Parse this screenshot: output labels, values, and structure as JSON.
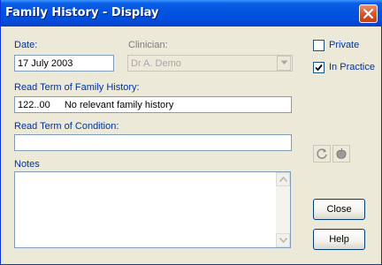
{
  "window": {
    "title": "Family History - Display",
    "close_glyph": "×"
  },
  "form": {
    "date_label": "Date:",
    "date_value": "17 July 2003",
    "clinician_label": "Clinician:",
    "clinician_value": "Dr A. Demo",
    "read_term_family_label": "Read Term of Family History:",
    "read_term_family_code": "122..00",
    "read_term_family_text": "No relevant family history",
    "read_term_condition_label": "Read Term of Condition:",
    "read_term_condition_value": "",
    "notes_label": "Notes",
    "notes_value": ""
  },
  "options": {
    "private_label": "Private",
    "private_checked": false,
    "in_practice_label": "In Practice",
    "in_practice_checked": true
  },
  "buttons": {
    "close_label": "Close",
    "help_label": "Help"
  },
  "icons": {
    "close": "close-icon",
    "checkmark": "checkmark-icon",
    "refresh": "refresh-icon",
    "apple": "apple-icon",
    "dropdown": "chevron-down-icon"
  },
  "colors": {
    "titlebar": "#0454df",
    "label": "#003399",
    "window_bg": "#ece9d8",
    "field_border": "#7f9db9",
    "close_button": "#e0522a"
  }
}
